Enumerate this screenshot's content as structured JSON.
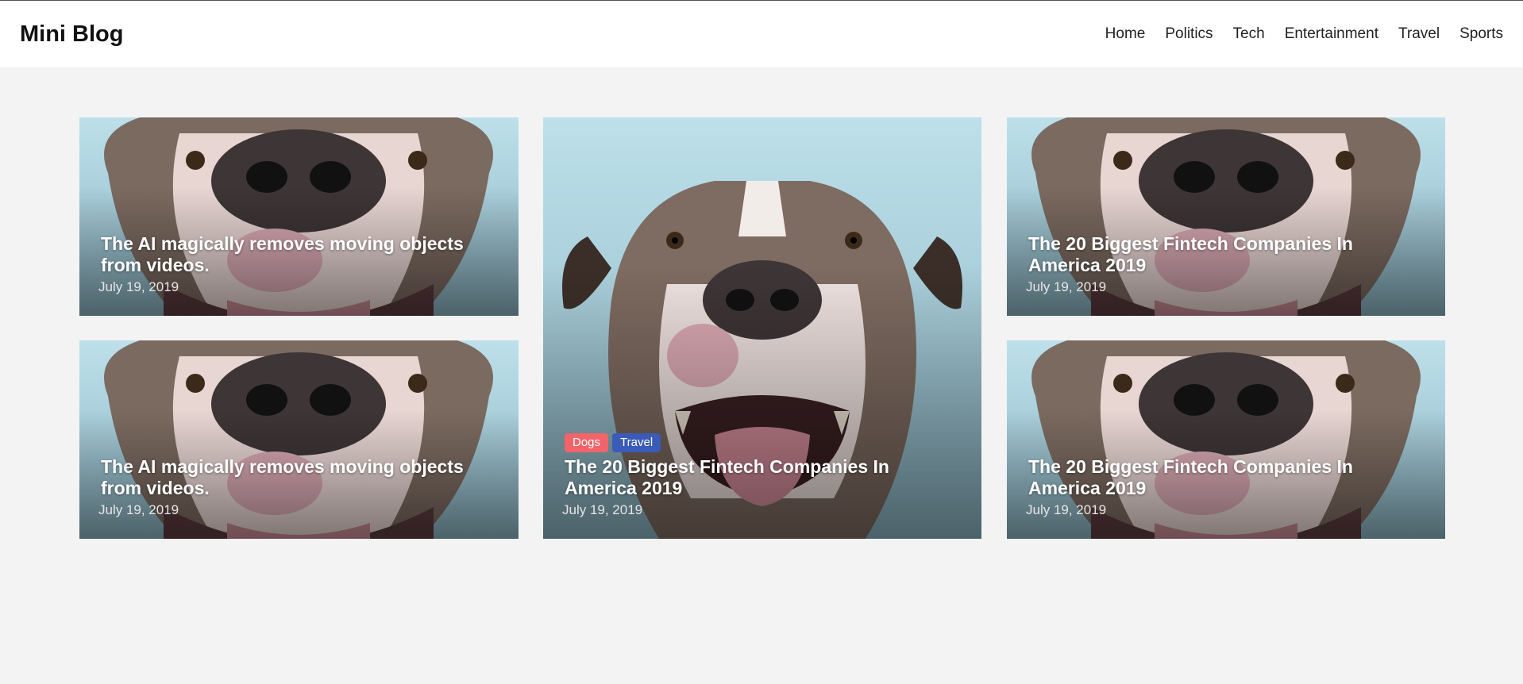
{
  "brand": "Mini Blog",
  "nav": [
    "Home",
    "Politics",
    "Tech",
    "Entertainment",
    "Travel",
    "Sports"
  ],
  "cards": [
    {
      "title": "The AI magically removes moving objects from videos.",
      "date": "July 19, 2019"
    },
    {
      "title": "The AI magically removes moving objects from videos.",
      "date": "July 19, 2019"
    },
    {
      "title": "The 20 Biggest Fintech Companies In America 2019",
      "date": "July 19, 2019",
      "tags": [
        "Dogs",
        "Travel"
      ]
    },
    {
      "title": "The 20 Biggest Fintech Companies In America 2019",
      "date": "July 19, 2019"
    },
    {
      "title": "The 20 Biggest Fintech Companies In America 2019",
      "date": "July 19, 2019"
    }
  ],
  "colors": {
    "tag_dogs": "#f0646a",
    "tag_travel": "#3a5bb8",
    "page_bg": "#f3f3f3"
  },
  "image_subject": "dog-photo"
}
